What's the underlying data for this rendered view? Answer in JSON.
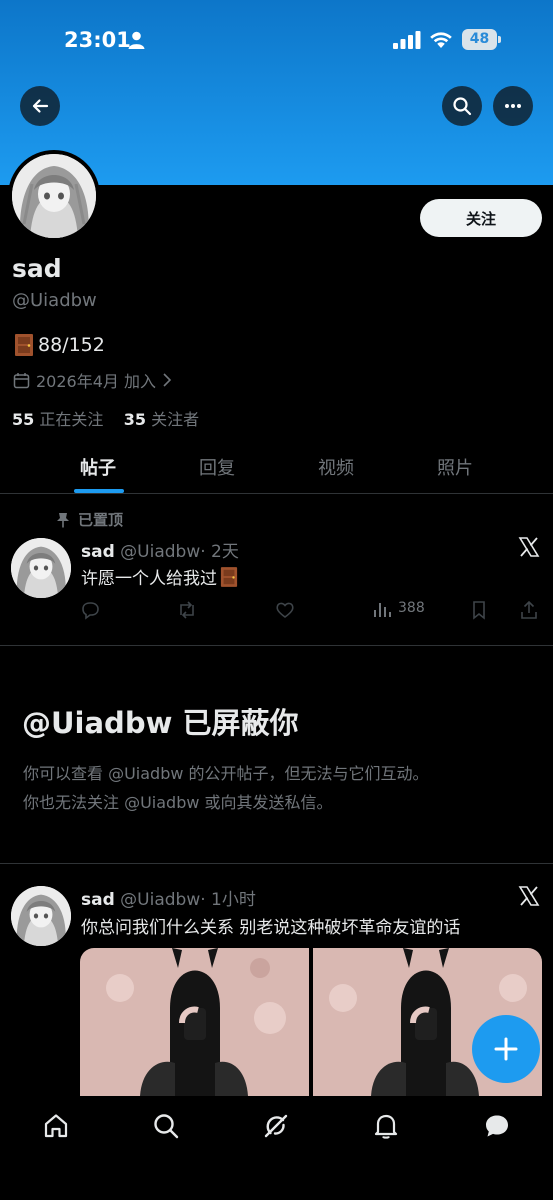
{
  "status_bar": {
    "time": "23:01",
    "battery": "48"
  },
  "header": {
    "back_icon": "arrow-left-icon",
    "search_icon": "search-icon",
    "more_icon": "more-icon"
  },
  "profile": {
    "follow_label": "关注",
    "name": "sad",
    "handle": "@Uiadbw",
    "bio_text": "88/152",
    "joined": "2026年4月 加入",
    "following_count": "55",
    "following_label": "正在关注",
    "followers_count": "35",
    "followers_label": "关注者"
  },
  "tabs": [
    {
      "label": "帖子"
    },
    {
      "label": "回复"
    },
    {
      "label": "视频"
    },
    {
      "label": "照片"
    }
  ],
  "pinned_label": "已置顶",
  "posts": [
    {
      "name": "sad",
      "handle": "@Uiadbw",
      "time": "· 2天",
      "text": "许愿一个人给我过",
      "views": "388"
    },
    {
      "name": "sad",
      "handle": "@Uiadbw",
      "time": "· 1小时",
      "text": "你总问我们什么关系 别老说这种破坏革命友谊的话"
    }
  ],
  "blocked": {
    "title": "@Uiadbw 已屏蔽你",
    "line1": "你可以查看 @Uiadbw 的公开帖子，但无法与它们互动。",
    "line2": "你也无法关注 @Uiadbw 或向其发送私信。"
  },
  "colors": {
    "accent": "#1d9bf0",
    "background": "#000000",
    "secondary_text": "#71767b"
  }
}
